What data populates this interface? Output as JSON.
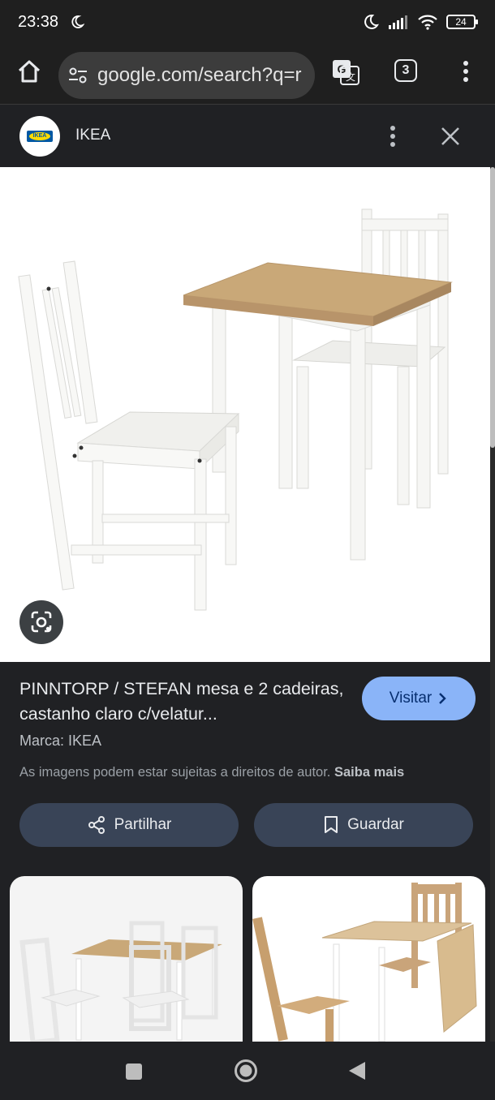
{
  "status_bar": {
    "time": "23:38",
    "battery": "24"
  },
  "browser": {
    "url": "google.com/search?q=r",
    "tab_count": "3"
  },
  "panel": {
    "site_name": "IKEA",
    "logo_text": "IKEA"
  },
  "product": {
    "title": "PINNTORP / STEFAN mesa e 2 cadeiras, castanho claro c/velatur...",
    "brand": "Marca: IKEA",
    "visit_label": "Visitar",
    "copyright_text": "As imagens podem estar sujeitas a direitos de autor.",
    "learn_more": "Saiba mais"
  },
  "actions": {
    "share_label": "Partilhar",
    "save_label": "Guardar"
  },
  "icons": {
    "home": "home-icon",
    "tune": "tune-icon",
    "translate": "translate-icon",
    "more": "more-vert-icon",
    "close": "close-icon",
    "lens": "lens-icon",
    "share": "share-icon",
    "bookmark": "bookmark-icon",
    "chevron": "chevron-right-icon"
  },
  "colors": {
    "accent": "#8ab4f8",
    "chip": "#394457",
    "background": "#202124"
  }
}
